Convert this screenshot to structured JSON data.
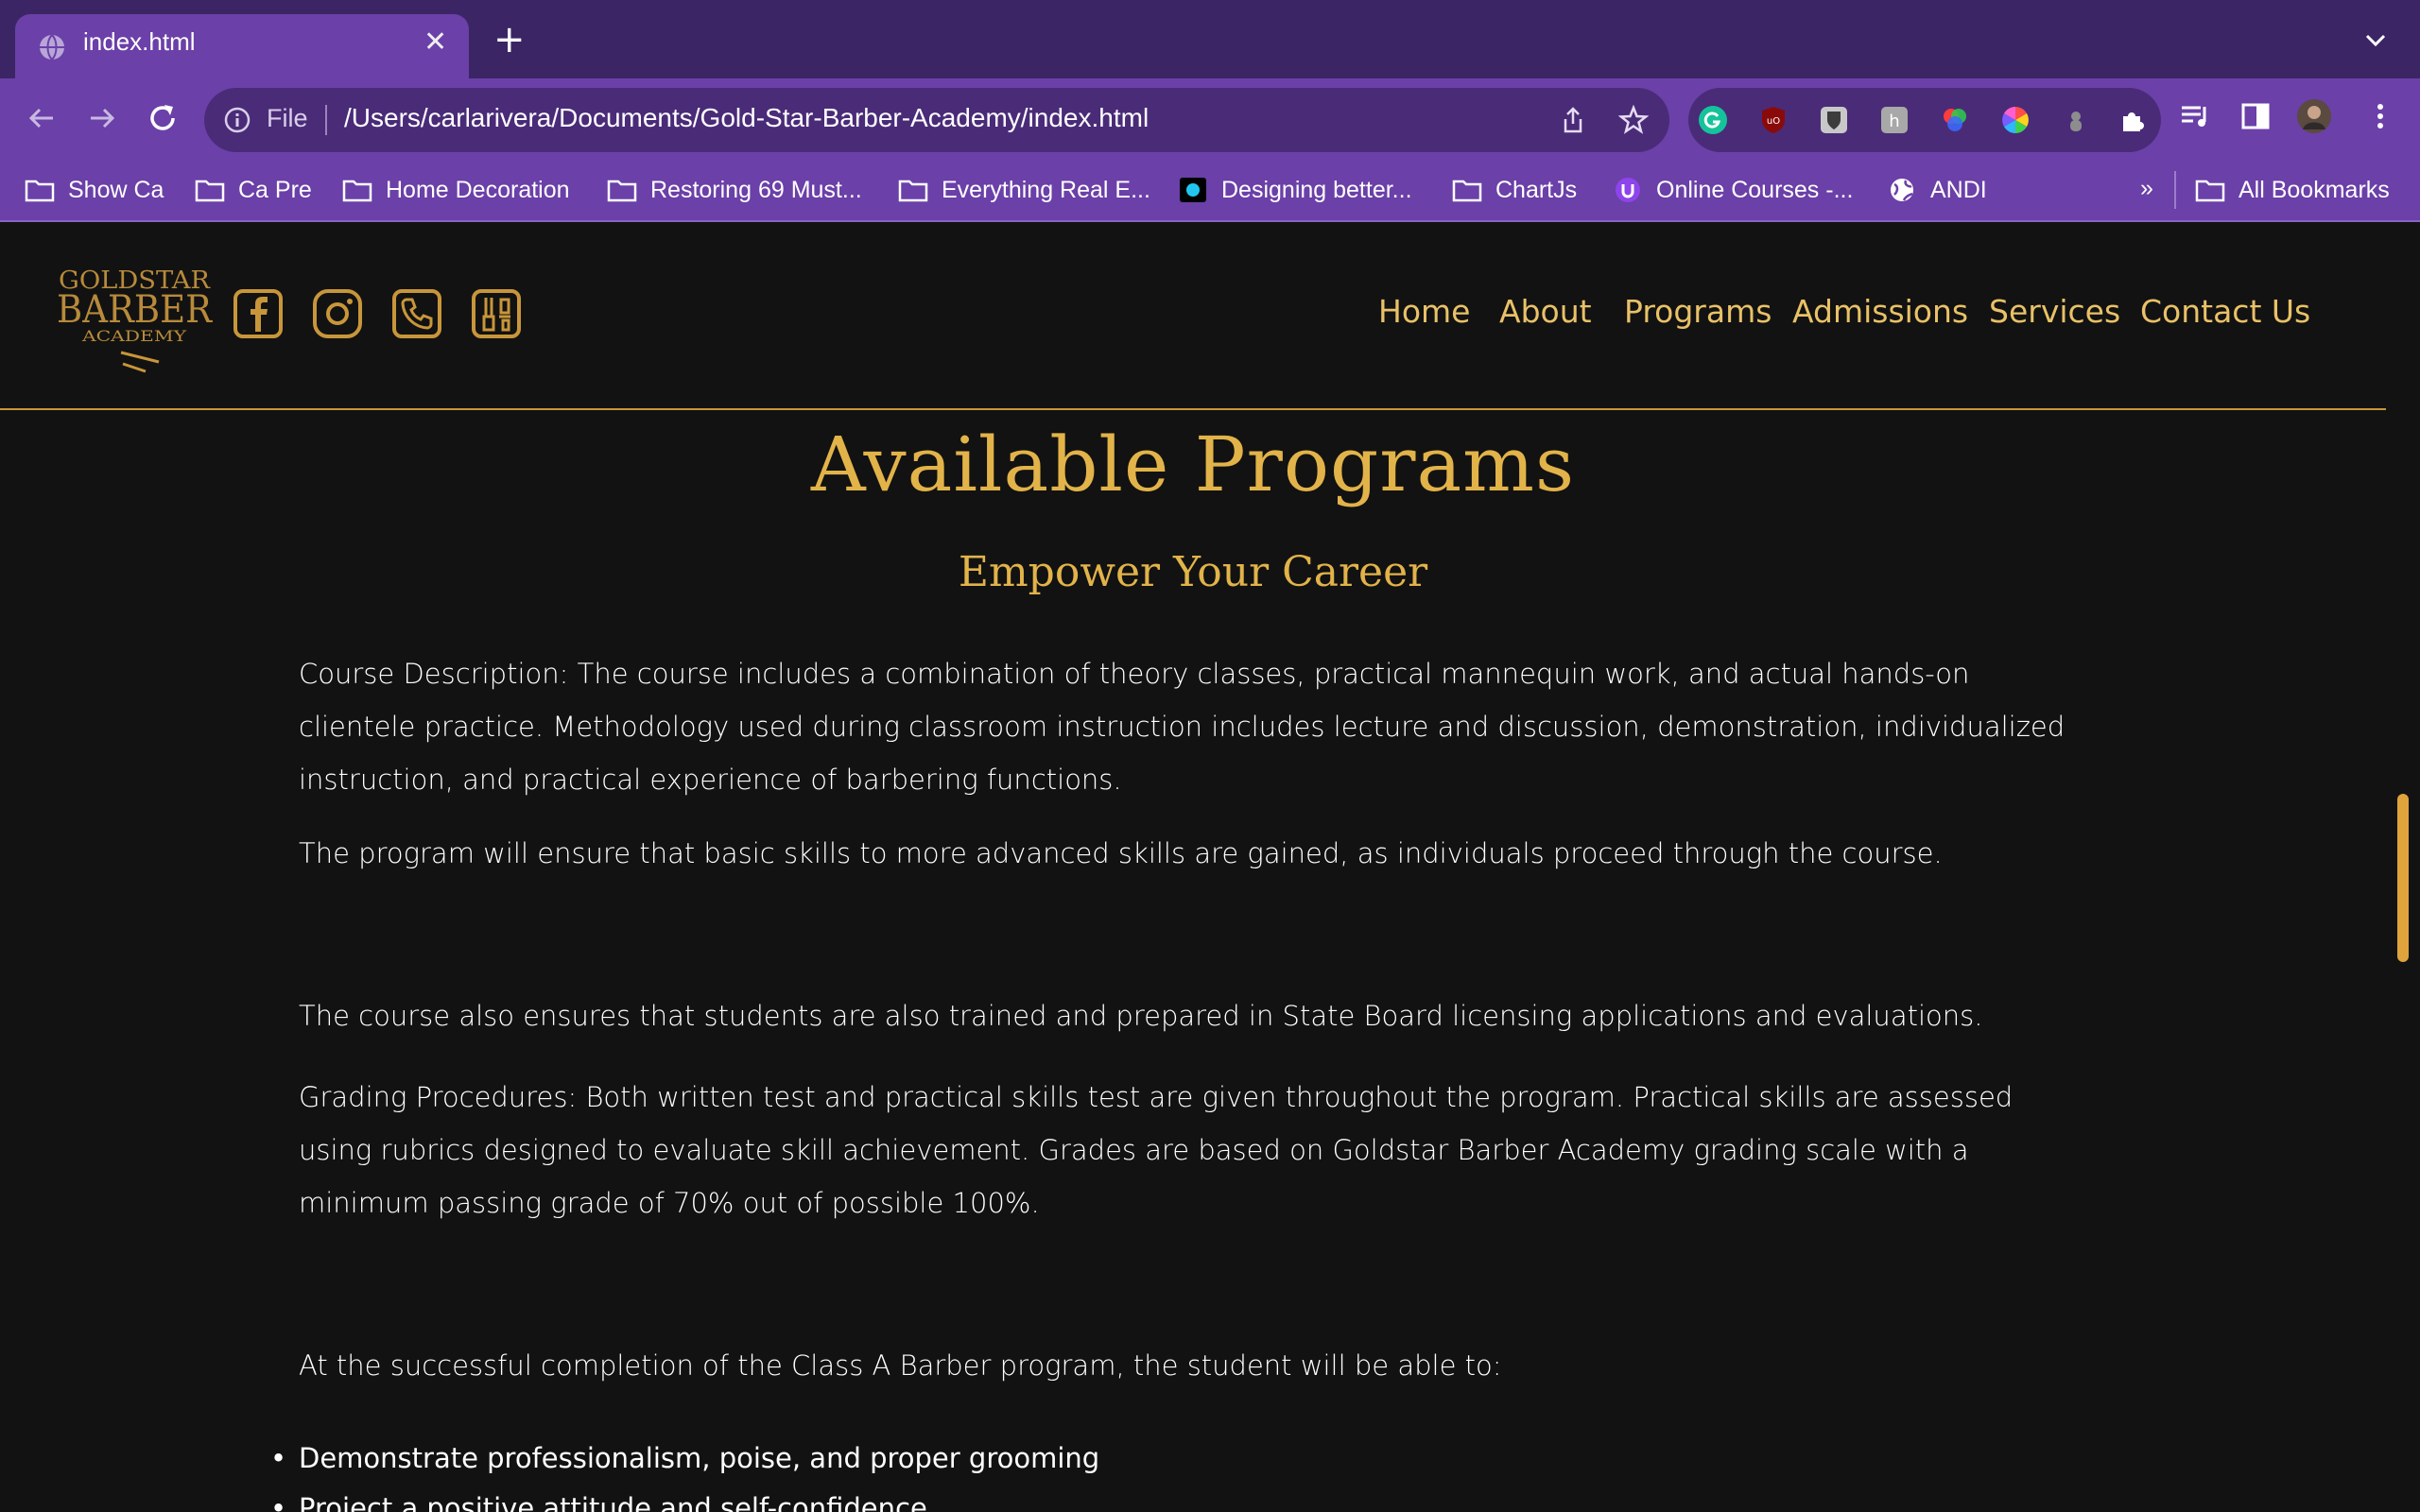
{
  "browser": {
    "tab_title": "index.html",
    "new_tab_symbol": "+",
    "close_symbol": "✕",
    "url_scheme": "File",
    "url_path": "/Users/carlarivera/Documents/Gold-Star-Barber-Academy/index.html",
    "bookmarks": [
      {
        "label": "Show Ca",
        "icon": "folder-icon"
      },
      {
        "label": "Ca Pre",
        "icon": "folder-icon"
      },
      {
        "label": "Home Decoration",
        "icon": "folder-icon"
      },
      {
        "label": "Restoring 69 Must...",
        "icon": "folder-icon"
      },
      {
        "label": "Everything Real E...",
        "icon": "folder-icon"
      },
      {
        "label": "Designing better...",
        "icon": "site-icon"
      },
      {
        "label": "ChartJs",
        "icon": "folder-icon"
      },
      {
        "label": "Online Courses -...",
        "icon": "site-icon"
      },
      {
        "label": "ANDI",
        "icon": "globe-icon"
      }
    ],
    "bookmarks_overflow": "»",
    "all_bookmarks": "All Bookmarks"
  },
  "site": {
    "logo_text": [
      "GOLDSTAR",
      "BARBER",
      "ACADEMY"
    ],
    "nav": [
      "Home",
      "About",
      "Programs",
      "Admissions",
      "Services",
      "Contact Us"
    ],
    "title": "Available Programs",
    "subtitle": "Empower Your Career",
    "paragraphs": [
      "Course Description: The course includes a combination of theory classes, practical mannequin work, and actual hands-on clientele practice. Methodology used during classroom instruction includes lecture and discussion, demonstration, individualized instruction, and practical experience of barbering functions.",
      "The program will ensure that basic skills to more advanced skills are gained, as individuals proceed through the course.",
      "The course also ensures that students are also trained and prepared in State Board licensing applications and evaluations.",
      "Grading Procedures: Both written test and practical skills test are given throughout the program. Practical skills are assessed using rubrics designed to evaluate skill achievement. Grades are based on Goldstar Barber Academy grading scale with a minimum passing grade of 70% out of possible 100%.",
      "At the successful completion of the Class A Barber program, the student will be able to:"
    ],
    "bullets": [
      "Demonstrate professionalism, poise, and proper grooming",
      "Project a positive attitude and self-confidence"
    ]
  },
  "colors": {
    "accent_gold": "#e2b349",
    "browser_purple": "#6b40a8",
    "page_bg": "#121212"
  }
}
